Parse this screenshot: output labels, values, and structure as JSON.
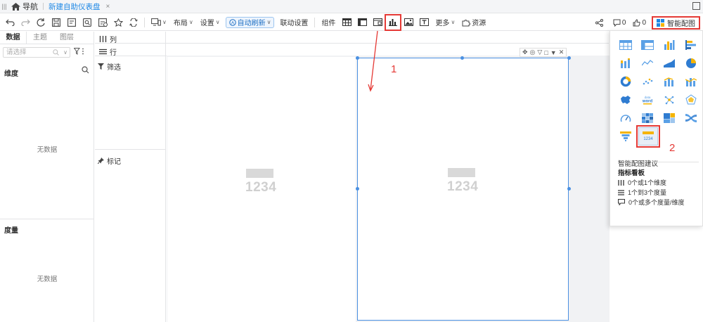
{
  "nav": {
    "home_label": "导航",
    "tab_label": "新建自助仪表盘",
    "tab_close": "×"
  },
  "toolbar": {
    "layout_label": "布局",
    "settings_label": "设置",
    "auto_refresh_label": "自动刷新",
    "linkage_label": "联动设置",
    "component_label": "组件",
    "more_label": "更多",
    "resources_label": "资源",
    "comments_count": "0",
    "likes_count": "0",
    "smart_chart_label": "智能配图"
  },
  "left_panel": {
    "tabs": [
      "数据",
      "主题",
      "图层"
    ],
    "search_placeholder": "请选择",
    "dimension_title": "维度",
    "dimension_empty": "无数据",
    "measure_title": "度量",
    "measure_empty": "无数据"
  },
  "field_panel": {
    "columns_label": "列",
    "rows_label": "行",
    "filter_label": "筛选",
    "mark_label": "标记"
  },
  "canvas": {
    "widgets": [
      {
        "value": "1234"
      },
      {
        "value": "1234"
      }
    ]
  },
  "smart_chart": {
    "chart_icons": [
      "table-icon",
      "crosstab-icon",
      "column-chart-icon",
      "bar-chart-icon",
      "stacked-column-icon",
      "line-chart-icon",
      "area-chart-icon",
      "pie-chart-icon",
      "ring-chart-icon",
      "scatter-chart-icon",
      "combo-chart-icon",
      "dual-axis-chart-icon",
      "map-icon",
      "word-cloud-icon",
      "network-icon",
      "radar-chart-icon",
      "gauge-icon",
      "heatmap-icon",
      "treemap-icon",
      "sankey-icon",
      "funnel-icon",
      "kpi-card-icon"
    ],
    "kpi_icon_text": "1234",
    "suggestion_title": "智能配图建议",
    "selected_type": "指标看板",
    "requirements": [
      "0个或1个维度",
      "1个到3个度量",
      "0个或多个度量/维度"
    ]
  },
  "annotations": {
    "step1": "1",
    "step2": "2"
  },
  "colors": {
    "accent": "#1e88e5",
    "highlight": "#e53935",
    "selection": "#4a90e2"
  }
}
